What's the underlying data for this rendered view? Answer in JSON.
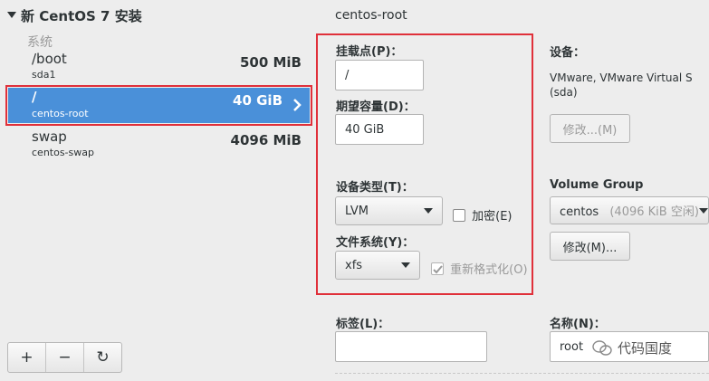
{
  "tree": {
    "header": "新 CentOS 7 安装",
    "section_label": "系统",
    "mounts": [
      {
        "name": "/boot",
        "device": "sda1",
        "size": "500 MiB"
      },
      {
        "name": "/",
        "device": "centos-root",
        "size": "40 GiB"
      },
      {
        "name": "swap",
        "device": "centos-swap",
        "size": "4096 MiB"
      }
    ],
    "toolbar": {
      "add": "+",
      "remove": "−",
      "refresh": "↻"
    }
  },
  "details": {
    "title": "centos-root",
    "mount_point_label": "挂载点(P)：",
    "mount_point_value": "/",
    "desired_capacity_label": "期望容量(D)：",
    "desired_capacity_value": "40 GiB",
    "device_type_label": "设备类型(T)：",
    "device_type_value": "LVM",
    "encrypt_label": "加密(E)",
    "filesystem_label": "文件系统(Y)：",
    "filesystem_value": "xfs",
    "reformat_label": "重新格式化(O)",
    "devices_label": "设备：",
    "devices_value": "VMware, VMware Virtual S (sda)",
    "modify_devices_button": "修改...(M)",
    "volume_group_label": "Volume Group",
    "volume_group_value": "centos",
    "volume_group_free": "(4096 KiB 空闲)",
    "modify_vg_button": "修改(M)...",
    "tag_label": "标签(L)：",
    "tag_value": "",
    "name_label": "名称(N)：",
    "name_value": "root"
  },
  "watermark": {
    "text": "代码国度"
  },
  "colors": {
    "selection": "#4a90d9",
    "highlight_box": "#e0303a"
  }
}
